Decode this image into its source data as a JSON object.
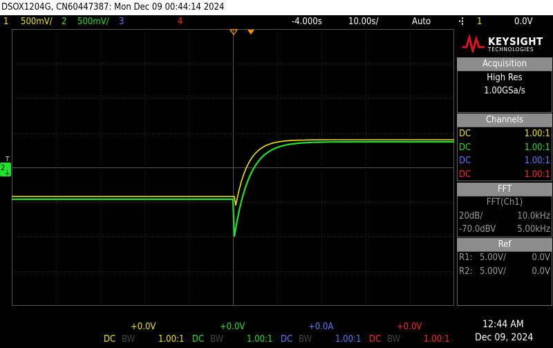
{
  "title": "DSOX1204G, CN60447387: Mon Dec 09 00:44:14 2024",
  "topbar": {
    "ch1_num": "1",
    "ch1_scale": "500mV/",
    "ch2_num": "2",
    "ch2_scale": "500mV/",
    "ch3_num": "3",
    "ch4_num": "4",
    "time_delay": "-4.000s",
    "time_scale": "10.00s/",
    "trigger_mode": "Auto",
    "trigger_icon": "rising-edge-icon",
    "trigger_source": "1",
    "trigger_level": "0.0V"
  },
  "brand": {
    "name": "KEYSIGHT",
    "sub": "TECHNOLOGIES"
  },
  "acquisition": {
    "header": "Acquisition",
    "mode": "High Res",
    "rate": "1.00GSa/s"
  },
  "channels": {
    "header": "Channels",
    "rows": [
      {
        "coupling": "DC",
        "ratio": "1.00:1",
        "color": "#f2e600"
      },
      {
        "coupling": "DC",
        "ratio": "1.00:1",
        "color": "#22e32c"
      },
      {
        "coupling": "DC",
        "ratio": "1.00:1",
        "color": "#5b7cff"
      },
      {
        "coupling": "DC",
        "ratio": "1.00:1",
        "color": "#ff2a2a"
      }
    ]
  },
  "fft": {
    "header": "FFT",
    "source": "FFT(Ch1)",
    "scale": "20dB/",
    "span": "10.0kHz",
    "ref": "-70.0dBV",
    "center": "5.00kHz"
  },
  "ref": {
    "header": "Ref",
    "r1_label": "R1:",
    "r1_scale": "5.00V/",
    "r1_offset": "0.0V",
    "r2_label": "R2:",
    "r2_scale": "5.00V/",
    "r2_offset": "0.0V"
  },
  "bottom": {
    "ch1_offset": "+0.0V",
    "ch2_offset": "+0.0V",
    "ch3_offset": "+0.0A",
    "ch4_offset": "+0.0V",
    "coupling": "DC",
    "bw": "BW",
    "ratio": "1.00:1",
    "time": "12:44 AM",
    "date": "Dec 09, 2024"
  },
  "markers": {
    "trigger_t": "T",
    "ch2_ground": "2"
  },
  "colors": {
    "ch1": "#f2e600",
    "ch2": "#22e32c",
    "ch3": "#5b7cff",
    "ch4": "#ff2a2a",
    "trigger": "#ff8c00"
  }
}
